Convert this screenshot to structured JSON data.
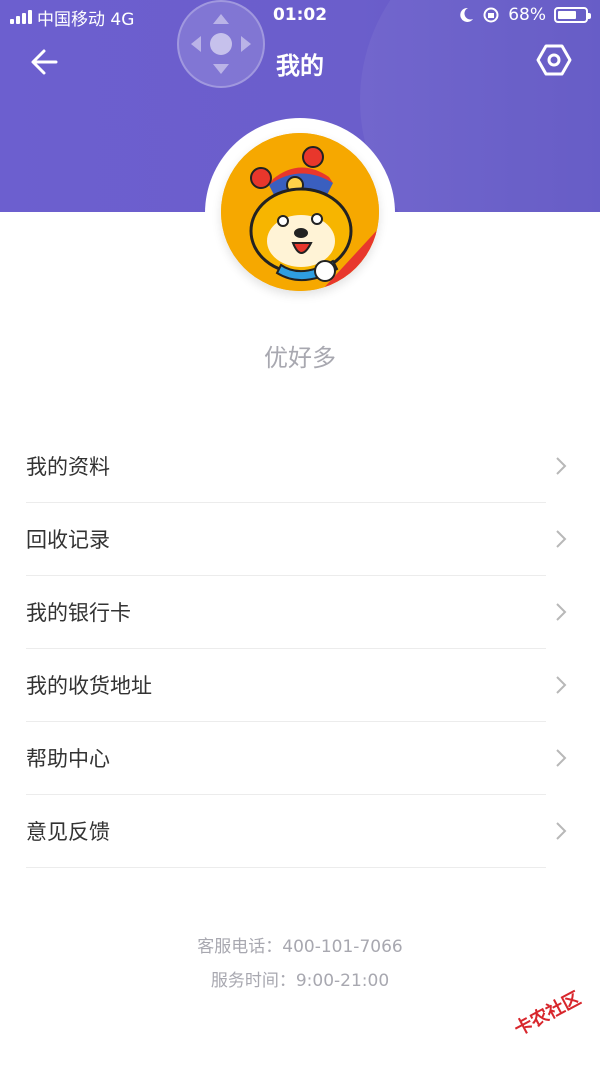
{
  "status_bar": {
    "carrier": "中国移动  4G",
    "time": "01:02",
    "battery": "68%"
  },
  "nav": {
    "title": "我的"
  },
  "profile": {
    "username": "优好多"
  },
  "menu": [
    {
      "label": "我的资料"
    },
    {
      "label": "回收记录"
    },
    {
      "label": "我的银行卡"
    },
    {
      "label": "我的收货地址"
    },
    {
      "label": "帮助中心"
    },
    {
      "label": "意见反馈"
    }
  ],
  "footer": {
    "phone": "客服电话：400-101-7066",
    "hours": "服务时间：9:00-21:00"
  },
  "watermark": {
    "text": "卡农社区"
  },
  "colors": {
    "header": "#6b5ecb",
    "accent_orange": "#f5a300"
  }
}
